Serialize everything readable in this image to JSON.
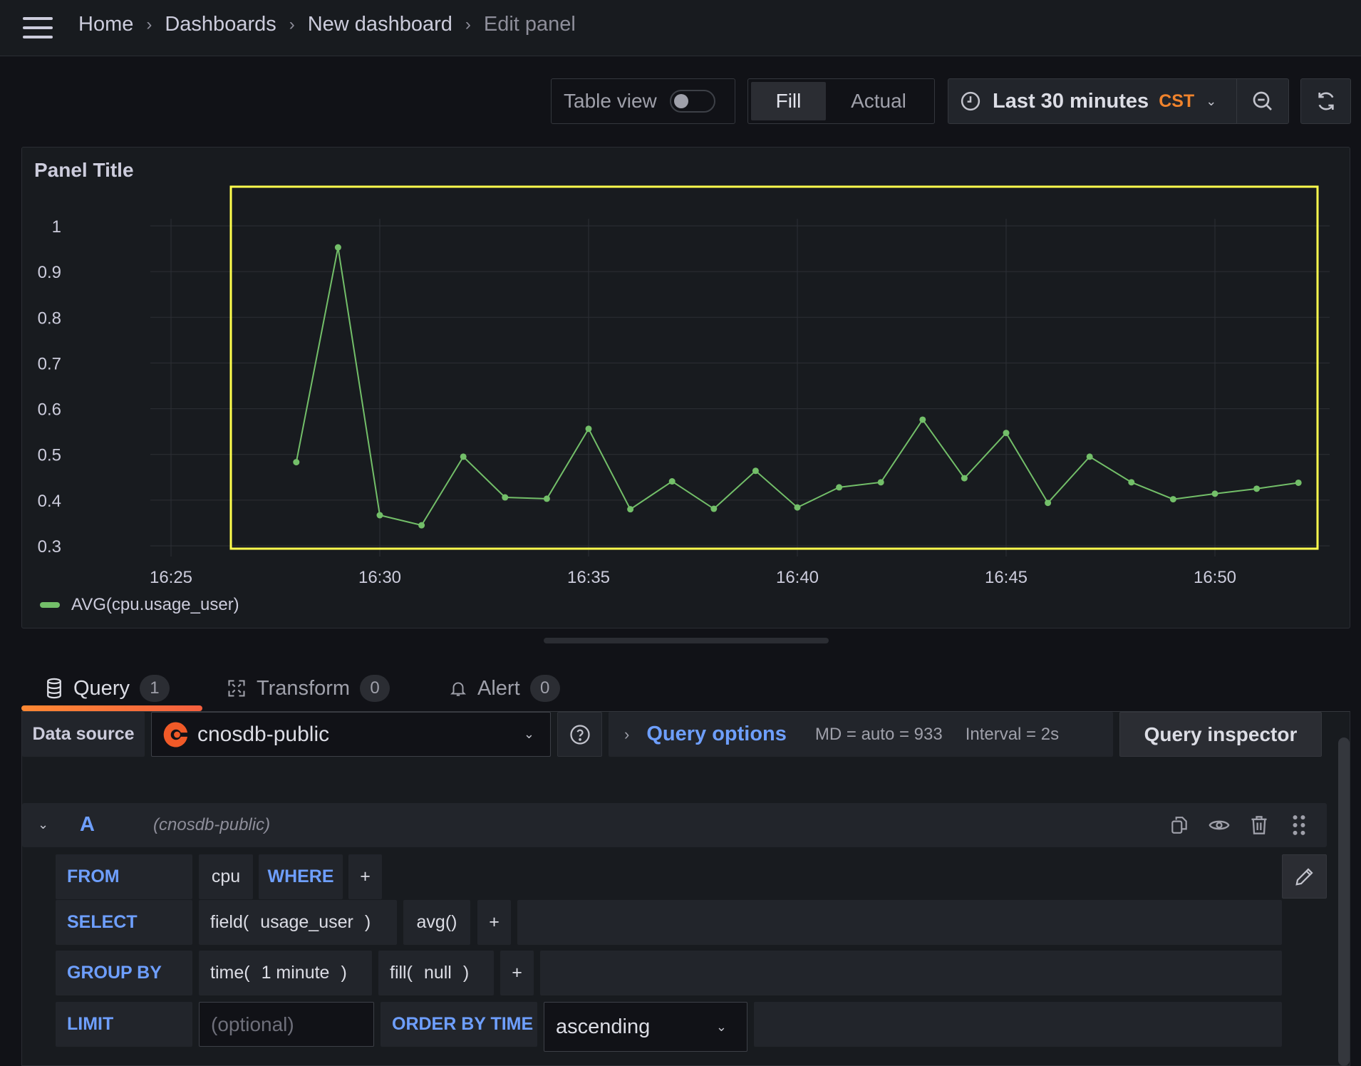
{
  "topbar": {
    "menu_icon": "hamburger-menu-icon",
    "breadcrumb": [
      {
        "label": "Home"
      },
      {
        "label": "Dashboards"
      },
      {
        "label": "New dashboard"
      },
      {
        "label": "Edit panel"
      }
    ],
    "separator": "›"
  },
  "toolbar": {
    "table_view_label": "Table view",
    "table_view_enabled": false,
    "fill_label": "Fill",
    "actual_label": "Actual",
    "selected_mode": "Fill",
    "time_range": "Last 30 minutes",
    "timezone": "CST",
    "caret": "⌄",
    "icons": {
      "clock": "clock-icon",
      "zoom_out": "zoom-out-icon",
      "refresh": "refresh-icon"
    }
  },
  "panel": {
    "title": "Panel Title",
    "highlight_color": "#ffff4d",
    "series_color": "#73bf69"
  },
  "chart_data": {
    "type": "line",
    "title": "Panel Title",
    "xlabel": "",
    "ylabel": "",
    "x_ticks": [
      "16:25",
      "16:30",
      "16:35",
      "16:40",
      "16:45",
      "16:50"
    ],
    "y_ticks": [
      "1",
      "0.9",
      "0.8",
      "0.7",
      "0.6",
      "0.5",
      "0.4",
      "0.3"
    ],
    "ylim": [
      0.3,
      1.0
    ],
    "x_range_minutes": [
      "16:22.3",
      "16:53.2"
    ],
    "grid": true,
    "legend": "bottom-left",
    "series": [
      {
        "name": "AVG(cpu.usage_user)",
        "color": "#73bf69",
        "x": [
          "16:28",
          "16:29",
          "16:30",
          "16:31",
          "16:32",
          "16:33",
          "16:34",
          "16:35",
          "16:36",
          "16:37",
          "16:38",
          "16:39",
          "16:40",
          "16:41",
          "16:42",
          "16:43",
          "16:44",
          "16:45",
          "16:46",
          "16:47",
          "16:48",
          "16:49",
          "16:50",
          "16:51",
          "16:52"
        ],
        "values": [
          0.483,
          0.953,
          0.367,
          0.345,
          0.495,
          0.406,
          0.403,
          0.556,
          0.38,
          0.441,
          0.381,
          0.464,
          0.384,
          0.428,
          0.439,
          0.576,
          0.448,
          0.547,
          0.394,
          0.495,
          0.439,
          0.402,
          0.414,
          0.425,
          0.438
        ]
      }
    ]
  },
  "tabs": [
    {
      "label": "Query",
      "count": "1",
      "icon": "database-icon",
      "active": true
    },
    {
      "label": "Transform",
      "count": "0",
      "icon": "transform-icon",
      "active": false
    },
    {
      "label": "Alert",
      "count": "0",
      "icon": "bell-icon",
      "active": false
    }
  ],
  "datasource": {
    "label": "Data source",
    "selected": "cnosdb-public",
    "logo_color": "#f05a28",
    "help_icon": "question-circle-icon",
    "query_options_label": "Query options",
    "md": "MD = auto = 933",
    "interval": "Interval = 2s",
    "query_inspector_label": "Query inspector"
  },
  "query": {
    "ref_id": "A",
    "datasource_name": "(cnosdb-public)",
    "header_icons": [
      "duplicate-icon",
      "eye-icon",
      "trash-icon",
      "drag-handle-icon"
    ],
    "from_label": "FROM",
    "measurement": "cpu",
    "where_label": "WHERE",
    "plus": "+",
    "select_label": "SELECT",
    "field_fn": "field(",
    "field_value": "usage_user",
    "close_paren": ")",
    "agg_fn": "avg()",
    "group_by_label": "GROUP BY",
    "time_fn": "time(",
    "time_value": "1 minute",
    "fill_fn": "fill(",
    "fill_value": "null",
    "limit_label": "LIMIT",
    "limit_placeholder": "(optional)",
    "limit_value": "",
    "order_label": "ORDER BY TIME",
    "order_value": "ascending"
  }
}
